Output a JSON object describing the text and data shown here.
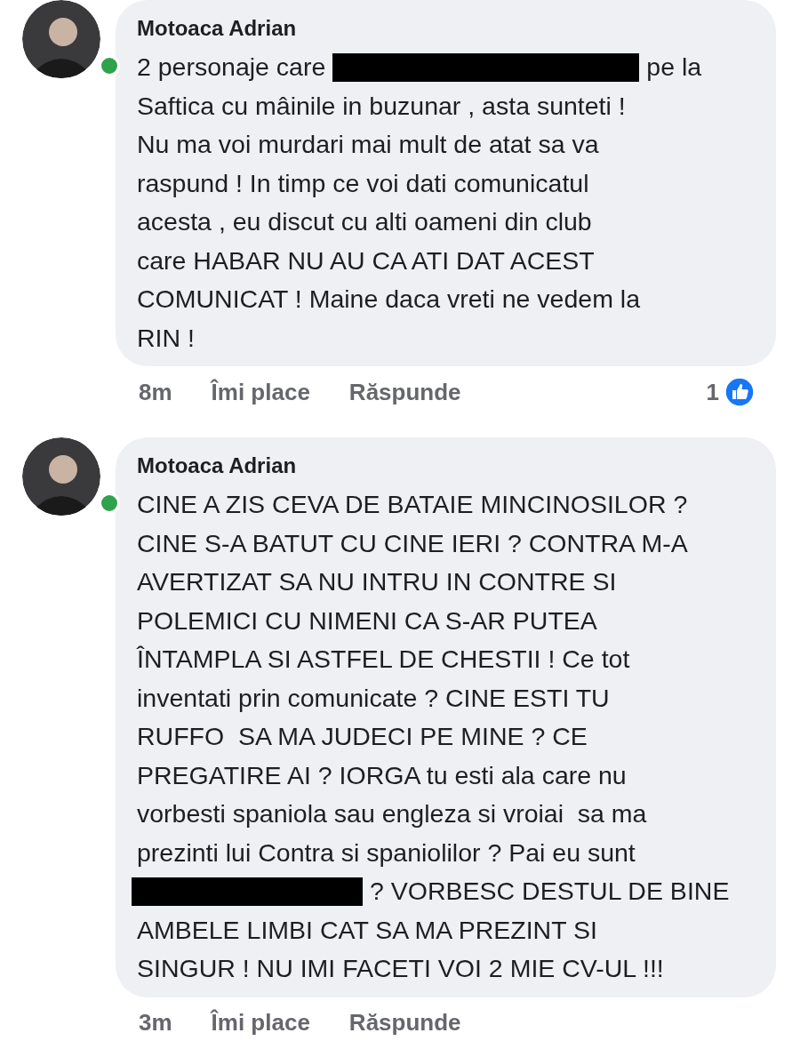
{
  "comments": [
    {
      "author": "Motoaca Adrian",
      "online": true,
      "lines": [
        [
          {
            "kind": "text",
            "text": "2 personaje care"
          },
          {
            "kind": "redaction"
          },
          {
            "kind": "text",
            "text": "pe la"
          }
        ],
        [
          {
            "kind": "text",
            "text": "Saftica cu mâinile in buzunar , asta sunteti !"
          }
        ],
        [
          {
            "kind": "text",
            "text": "Nu ma voi murdari mai mult de atat sa va"
          }
        ],
        [
          {
            "kind": "text",
            "text": "raspund ! In timp ce voi dati comunicatul"
          }
        ],
        [
          {
            "kind": "text",
            "text": "acesta , eu discut cu alti oameni din club"
          }
        ],
        [
          {
            "kind": "text",
            "text": "care HABAR NU AU CA ATI DAT ACEST"
          }
        ],
        [
          {
            "kind": "text",
            "text": "COMUNICAT ! Maine daca vreti ne vedem la"
          }
        ],
        [
          {
            "kind": "text",
            "text": "RIN !"
          }
        ]
      ],
      "time": "8m",
      "like": "Îmi place",
      "reply": "Răspunde",
      "reactions": "1"
    },
    {
      "author": "Motoaca Adrian",
      "online": true,
      "lines": [
        [
          {
            "kind": "text",
            "text": "CINE A ZIS CEVA DE BATAIE MINCINOSILOR ?"
          }
        ],
        [
          {
            "kind": "text",
            "text": "CINE S-A BATUT CU CINE IERI ? CONTRA M-A"
          }
        ],
        [
          {
            "kind": "text",
            "text": "AVERTIZAT SA NU INTRU IN CONTRE SI"
          }
        ],
        [
          {
            "kind": "text",
            "text": "POLEMICI CU NIMENI CA S-AR PUTEA"
          }
        ],
        [
          {
            "kind": "text",
            "text": "ÎNTAMPLA SI ASTFEL DE CHESTII ! Ce tot"
          }
        ],
        [
          {
            "kind": "text",
            "text": "inventati prin comunicate ? CINE ESTI TU"
          }
        ],
        [
          {
            "kind": "text",
            "text": "RUFFO  SA MA JUDECI PE MINE ? CE"
          }
        ],
        [
          {
            "kind": "text",
            "text": "PREGATIRE AI ? IORGA tu esti ala care nu"
          }
        ],
        [
          {
            "kind": "text",
            "text": "vorbesti spaniola sau engleza si vroiai  sa ma"
          }
        ],
        [
          {
            "kind": "text",
            "text": "prezinti lui Contra si spaniolilor ? Pai eu sunt"
          }
        ],
        [
          {
            "kind": "redaction"
          },
          {
            "kind": "text",
            "text": "? VORBESC DESTUL DE BINE"
          }
        ],
        [
          {
            "kind": "text",
            "text": "AMBELE LIMBI CAT SA MA PREZINT SI"
          }
        ],
        [
          {
            "kind": "text",
            "text": "SINGUR ! NU IMI FACETI VOI 2 MIE CV-UL !!!"
          }
        ]
      ],
      "time": "3m",
      "like": "Îmi place",
      "reply": "Răspunde"
    }
  ]
}
